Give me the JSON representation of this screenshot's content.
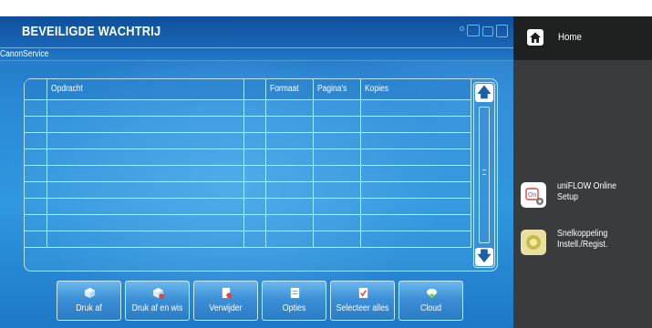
{
  "screen": {
    "title": "BEVEILIGDE WACHTRIJ",
    "user": "CanonService"
  },
  "table": {
    "columns": [
      "Opdracht",
      "",
      "Formaat",
      "Pagina's",
      "Kopies"
    ],
    "rows": []
  },
  "actions": [
    {
      "label": "Druk af",
      "icon": "print-icon"
    },
    {
      "label": "Druk af en wis",
      "icon": "print-and-delete-icon"
    },
    {
      "label": "Verwijder",
      "icon": "delete-icon"
    },
    {
      "label": "Opties",
      "icon": "options-icon"
    },
    {
      "label": "Selecteer alles",
      "icon": "select-all-icon"
    },
    {
      "label": "Cloud",
      "icon": "cloud-icon"
    }
  ],
  "side": {
    "home_label": "Home",
    "items": [
      {
        "line1": "uniFLOW Online",
        "line2": "Setup",
        "icon": "uniflow-setup-icon"
      },
      {
        "line1": "Snelkoppeling",
        "line2": "Instell./Regist.",
        "icon": "shortcut-icon"
      }
    ]
  },
  "colors": {
    "accent": "#2a8ad6",
    "title_bar": "#0d4f9c",
    "side_panel": "#3a3b3c",
    "home_bar": "#1f2020"
  }
}
